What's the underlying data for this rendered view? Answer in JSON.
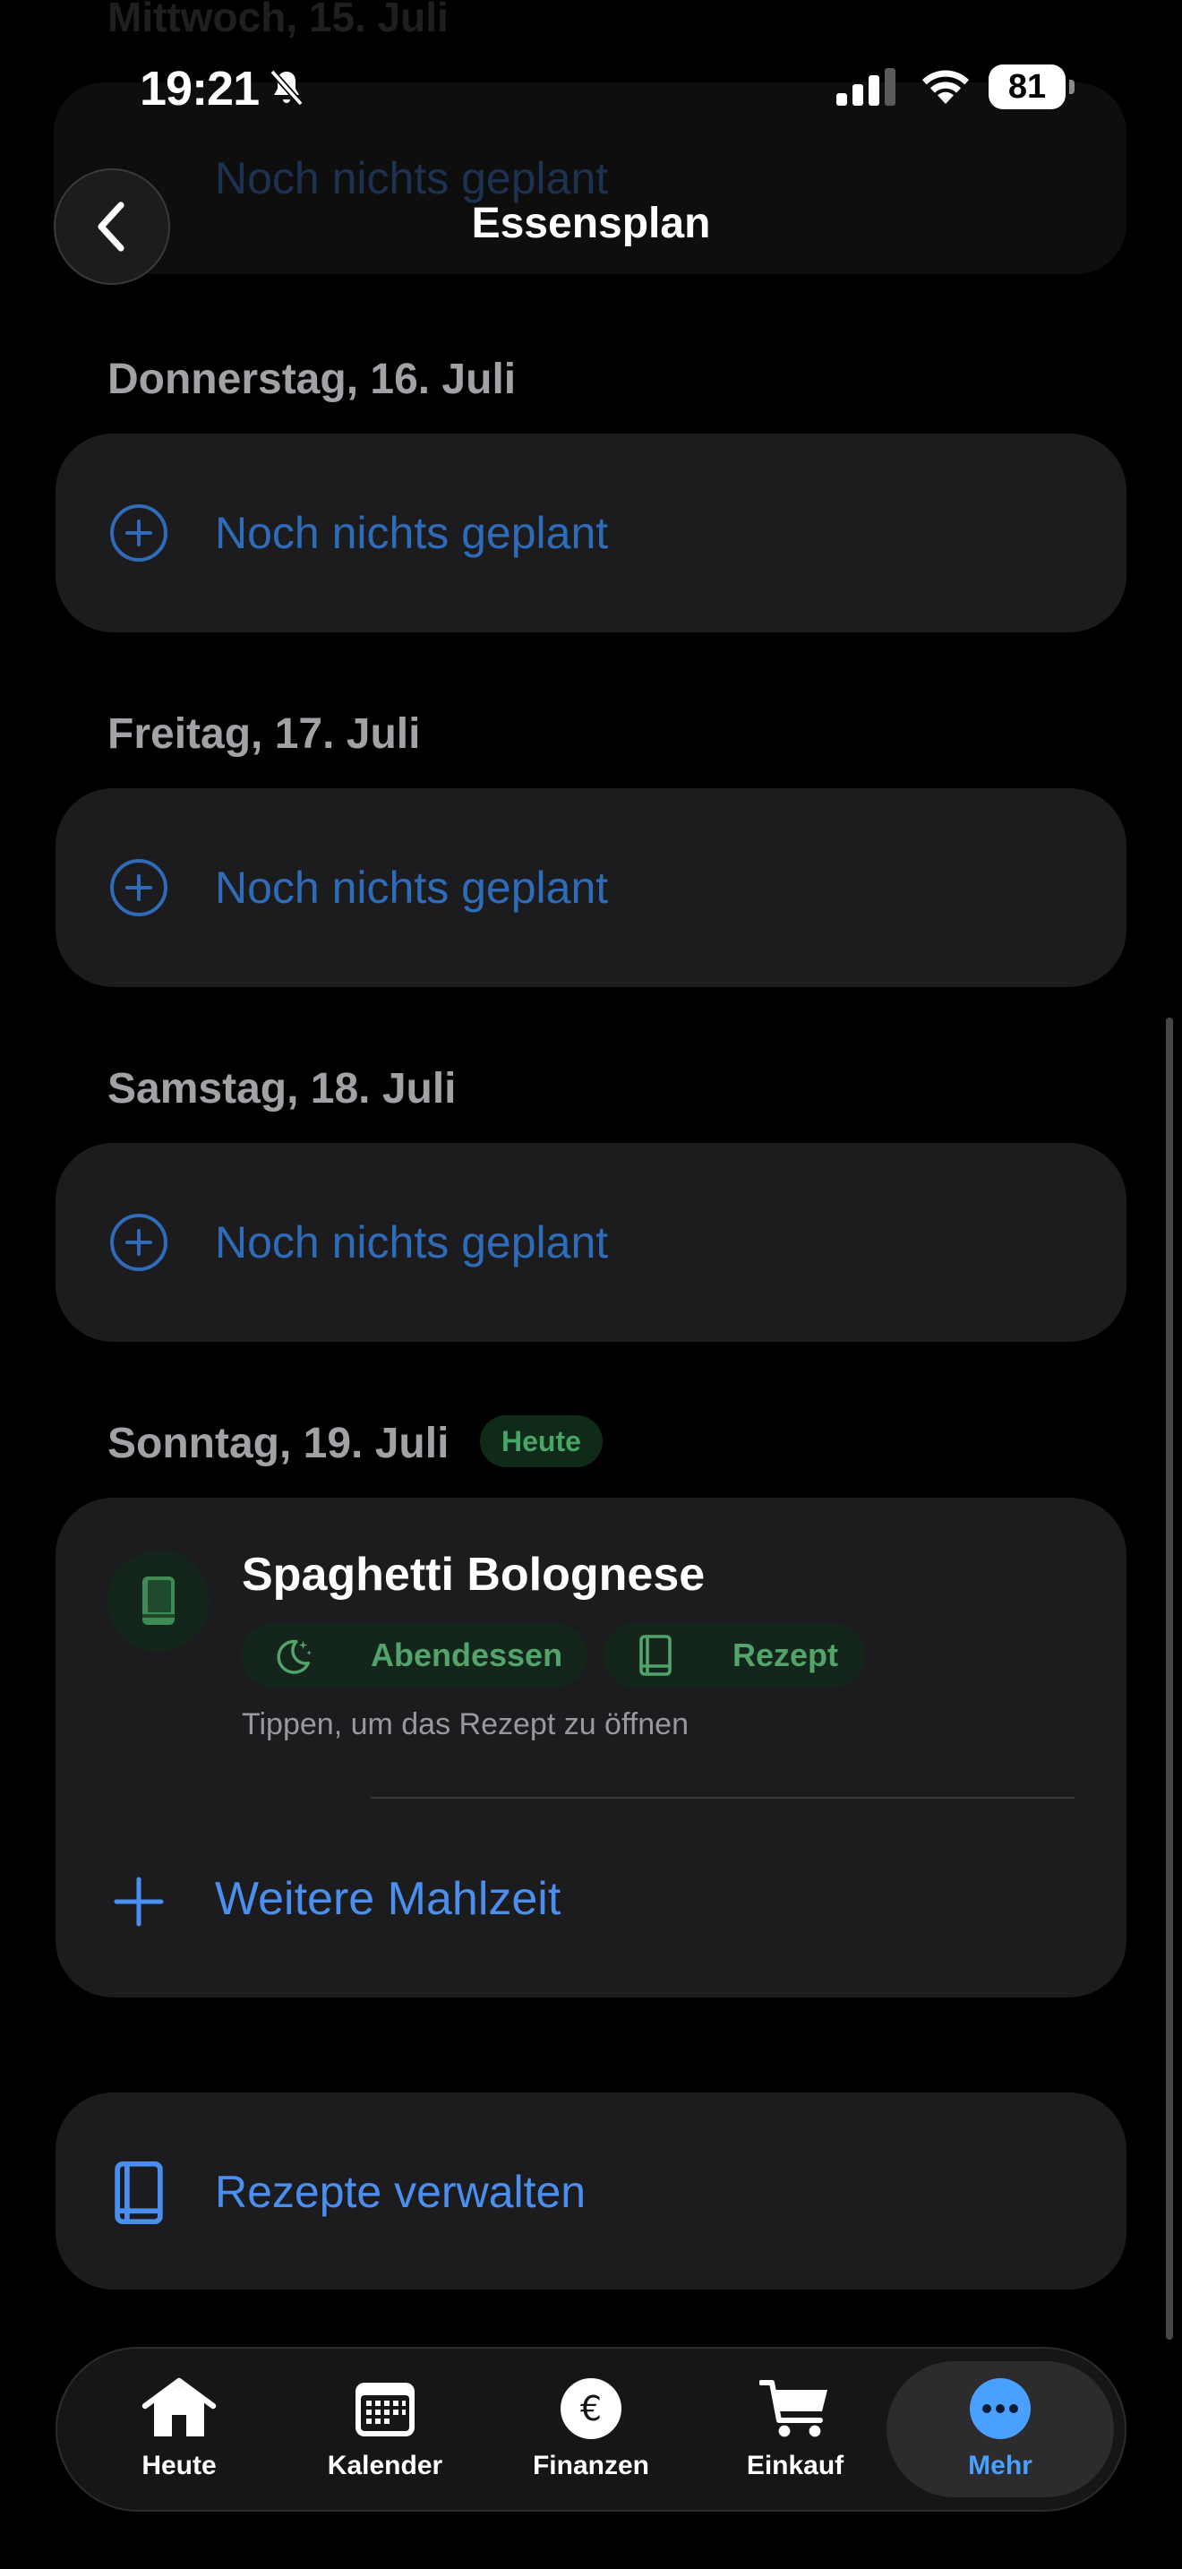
{
  "status_bar": {
    "time": "19:21",
    "battery": "81"
  },
  "background": {
    "date": "Mittwoch, 15. Juli",
    "empty_label": "Noch nichts geplant"
  },
  "header": {
    "title": "Essensplan"
  },
  "days": [
    {
      "date": "Donnerstag, 16. Juli",
      "empty_label": "Noch nichts geplant"
    },
    {
      "date": "Freitag, 17. Juli",
      "empty_label": "Noch nichts geplant"
    },
    {
      "date": "Samstag, 18. Juli",
      "empty_label": "Noch nichts geplant"
    }
  ],
  "today": {
    "date": "Sonntag, 19. Juli",
    "badge": "Heute",
    "meal": {
      "title": "Spaghetti Bolognese",
      "meal_type": "Abendessen",
      "source": "Rezept",
      "hint": "Tippen, um das Rezept zu öffnen"
    },
    "add_label": "Weitere Mahlzeit"
  },
  "recipes": {
    "label": "Rezepte verwalten"
  },
  "tabs": [
    {
      "label": "Heute",
      "icon": "house-icon"
    },
    {
      "label": "Kalender",
      "icon": "calendar-icon"
    },
    {
      "label": "Finanzen",
      "icon": "euro-icon"
    },
    {
      "label": "Einkauf",
      "icon": "cart-icon"
    },
    {
      "label": "Mehr",
      "icon": "ellipsis-icon",
      "active": true
    }
  ],
  "colors": {
    "accent": "#4a8ff0",
    "green": "#53a36a",
    "card": "#1c1c1e"
  }
}
